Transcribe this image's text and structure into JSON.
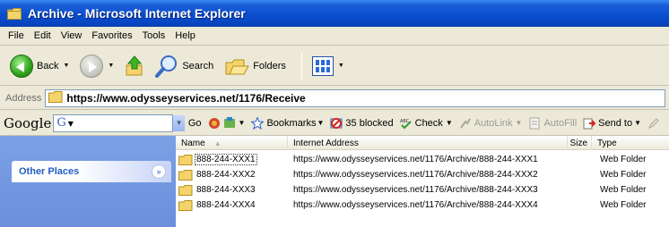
{
  "window": {
    "title": "Archive - Microsoft Internet Explorer"
  },
  "menu": [
    "File",
    "Edit",
    "View",
    "Favorites",
    "Tools",
    "Help"
  ],
  "toolbar": {
    "back_label": "Back",
    "search_label": "Search",
    "folders_label": "Folders"
  },
  "address": {
    "label": "Address",
    "url": "https://www.odysseyservices.net/1176/Receive"
  },
  "google": {
    "logo": "Google",
    "search_prefix": "G",
    "go_label": "Go",
    "bookmarks_label": "Bookmarks",
    "blocked_label": "35 blocked",
    "check_label": "Check",
    "autolink_label": "AutoLink",
    "autofill_label": "AutoFill",
    "sendto_label": "Send to"
  },
  "taskpane": {
    "section_title": "Other Places"
  },
  "columns": {
    "name": "Name",
    "address": "Internet Address",
    "size": "Size",
    "type": "Type"
  },
  "rows": [
    {
      "name": "888-244-XXX1",
      "address": "https://www.odysseyservices.net/1176/Archive/888-244-XXX1",
      "type": "Web Folder"
    },
    {
      "name": "888-244-XXX2",
      "address": "https://www.odysseyservices.net/1176/Archive/888-244-XXX2",
      "type": "Web Folder"
    },
    {
      "name": "888-244-XXX3",
      "address": "https://www.odysseyservices.net/1176/Archive/888-244-XXX3",
      "type": "Web Folder"
    },
    {
      "name": "888-244-XXX4",
      "address": "https://www.odysseyservices.net/1176/Archive/888-244-XXX4",
      "type": "Web Folder"
    }
  ],
  "colors": {
    "titlebar": "#0a4fd0",
    "chrome": "#ece9d8",
    "taskpane": "#7aa1e6",
    "taskpane_title": "#215dc6",
    "folder": "#f5d36b"
  }
}
